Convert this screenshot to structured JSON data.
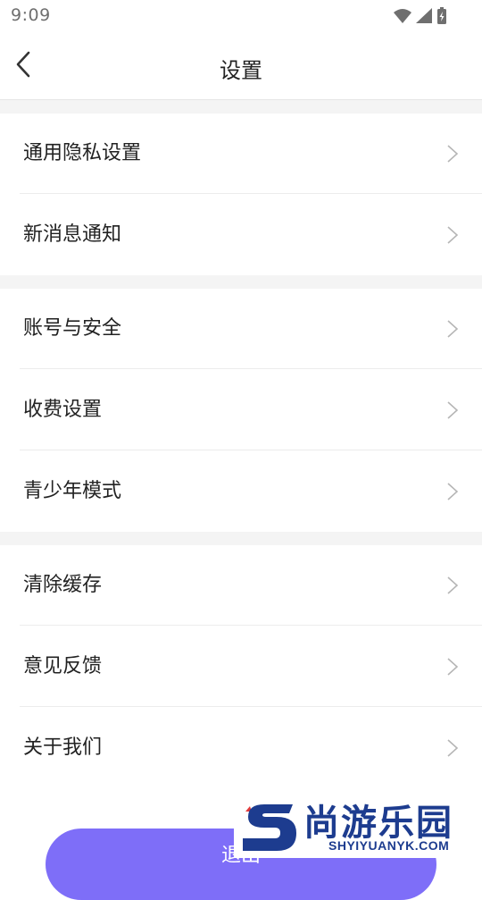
{
  "status_bar": {
    "time": "9:09"
  },
  "nav": {
    "title": "设置"
  },
  "sections": [
    {
      "items": [
        {
          "label": "通用隐私设置"
        },
        {
          "label": "新消息通知"
        }
      ]
    },
    {
      "items": [
        {
          "label": "账号与安全"
        },
        {
          "label": "收费设置"
        },
        {
          "label": "青少年模式"
        }
      ]
    },
    {
      "items": [
        {
          "label": "清除缓存"
        },
        {
          "label": "意见反馈"
        },
        {
          "label": "关于我们"
        }
      ]
    }
  ],
  "logout": {
    "label": "退出"
  },
  "watermark": {
    "title": "尚游乐园",
    "url": "SHYIYUANYK.COM"
  },
  "colors": {
    "accent": "#7e6ef8",
    "divider": "#ececec",
    "section_gap": "#f4f4f4"
  }
}
